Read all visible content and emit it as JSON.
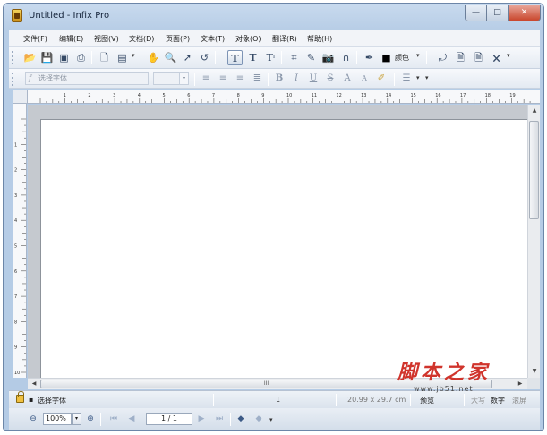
{
  "window": {
    "title": "Untitled - Infix Pro"
  },
  "window_controls": {
    "minimize": "—",
    "maximize": "□",
    "close": "✕"
  },
  "menu": [
    {
      "label": "文件(F)"
    },
    {
      "label": "编辑(E)"
    },
    {
      "label": "视图(V)"
    },
    {
      "label": "文档(D)"
    },
    {
      "label": "页面(P)"
    },
    {
      "label": "文本(T)"
    },
    {
      "label": "对象(O)"
    },
    {
      "label": "翻译(R)"
    },
    {
      "label": "帮助(H)"
    }
  ],
  "toolbar1": {
    "color_label": "颜色",
    "icons": {
      "open": "open-folder-icon",
      "save": "save-icon",
      "save_as": "save-as-icon",
      "print": "print-icon",
      "document": "document-icon",
      "page": "page-icon",
      "hand": "hand-icon",
      "zoom": "zoom-icon",
      "select": "arrow-select-icon",
      "undo": "undo-icon",
      "text_tool": "text-tool-icon",
      "text_edit": "text-edit-icon",
      "text_flow": "text-flow-icon",
      "crop": "crop-icon",
      "pen": "pen-icon",
      "camera": "camera-icon",
      "path": "path-icon",
      "eyedropper": "eyedropper-icon",
      "color": "color-swatch-icon"
    }
  },
  "toolbar2": {
    "font_placeholder": "选择字体",
    "font_size": "",
    "format": {
      "bold": "B",
      "italic": "I",
      "underline": "U",
      "strike": "S",
      "superscript": "A",
      "subscript": "A"
    }
  },
  "ruler": {
    "h_numbers": [
      "1",
      "2",
      "3",
      "4",
      "5",
      "6",
      "7",
      "8",
      "9",
      "10",
      "11",
      "12",
      "13",
      "14",
      "15",
      "16",
      "17",
      "18",
      "19"
    ],
    "v_numbers": [
      "1",
      "2",
      "3",
      "4",
      "5",
      "6",
      "7",
      "8",
      "9",
      "10"
    ]
  },
  "scroll": {
    "h_thumb_label": "III"
  },
  "status": {
    "font": "选择字体",
    "page_no": "1",
    "page_size": "20.99 x 29.7 cm",
    "mode": "预览",
    "caps": "大写",
    "num": "数字",
    "scroll": "滚屏"
  },
  "nav": {
    "zoom": "100%",
    "page": "1 / 1"
  },
  "watermark": {
    "text": "脚本之家",
    "url": "www.jb51.net"
  }
}
